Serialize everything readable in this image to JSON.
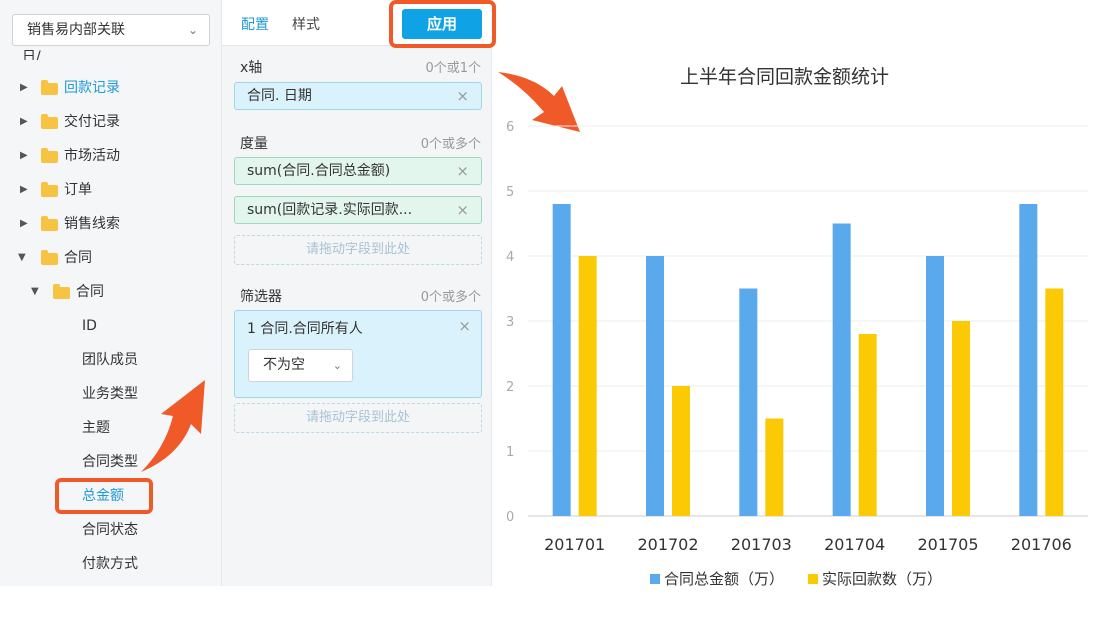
{
  "sidebar": {
    "source_select": "销售易内部关联",
    "partial_top_label": "日/",
    "folders": [
      {
        "label": "回款记录",
        "active": true
      },
      {
        "label": "交付记录"
      },
      {
        "label": "市场活动"
      },
      {
        "label": "订单"
      },
      {
        "label": "销售线索"
      },
      {
        "label": "合同",
        "expanded": true
      }
    ],
    "subfolder": {
      "label": "合同",
      "expanded": true
    },
    "fields": [
      "ID",
      "团队成员",
      "业务类型",
      "主题",
      "合同类型",
      "总金额",
      "合同状态",
      "付款方式"
    ],
    "highlighted_field": "总金额"
  },
  "config": {
    "tabs": [
      "配置",
      "样式"
    ],
    "apply_label": "应用",
    "xaxis": {
      "title": "x轴",
      "hint": "0个或1个",
      "chips": [
        "合同. 日期"
      ]
    },
    "measure": {
      "title": "度量",
      "hint": "0个或多个",
      "chips": [
        "sum(合同.合同总金额)",
        "sum(回款记录.实际回款..."
      ]
    },
    "drop_placeholder": "请拖动字段到此处",
    "filter": {
      "title": "筛选器",
      "hint": "0个或多个",
      "item": "1 合同.合同所有人",
      "condition": "不为空"
    }
  },
  "chart_data": {
    "type": "bar",
    "title": "上半年合同回款金额统计",
    "xlabel": "",
    "ylabel": "",
    "ylim": [
      0,
      6
    ],
    "yticks": [
      0,
      1,
      2,
      3,
      4,
      5,
      6
    ],
    "categories": [
      "201701",
      "201702",
      "201703",
      "201704",
      "201705",
      "201706"
    ],
    "series": [
      {
        "name": "合同总金额（万）",
        "color": "#5aa9ec",
        "values": [
          4.8,
          4.0,
          3.5,
          4.5,
          4.0,
          4.8
        ]
      },
      {
        "name": "实际回款数（万）",
        "color": "#fcca04",
        "values": [
          4.0,
          2.0,
          1.5,
          2.8,
          3.0,
          3.5
        ]
      }
    ],
    "grid": true,
    "legend_position": "bottom"
  },
  "colors": {
    "accent": "#0fa3e6",
    "highlight": "#f05a28",
    "folder": "#f6c343"
  }
}
